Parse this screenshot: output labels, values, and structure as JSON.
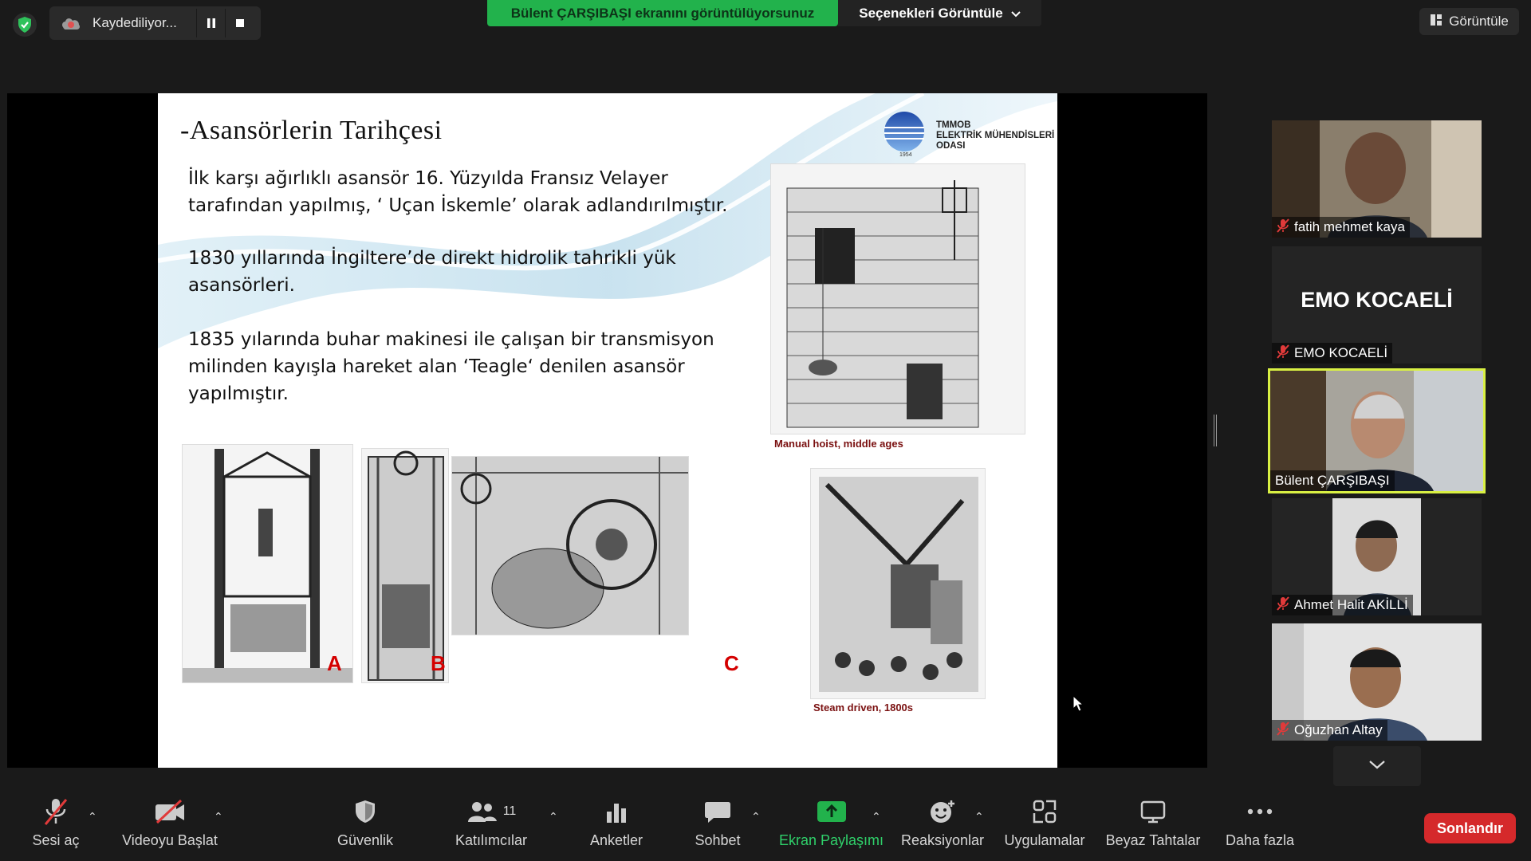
{
  "top": {
    "recording_label": "Kaydediliyor...",
    "share_banner": "Bülent ÇARŞIBAŞI ekranını görüntülüyorsunuz",
    "options_label": "Seçenekleri Görüntüle",
    "view_label": "Görüntüle"
  },
  "slide": {
    "title": "-Asansörlerin   Tarihçesi",
    "logo_lines": [
      "TMMOB",
      "ELEKTRİK MÜHENDİSLERİ",
      "ODASI"
    ],
    "logo_year": "1954",
    "paragraphs": [
      "İlk karşı ağırlıklı asansör 16. Yüzyılda Fransız Velayer tarafından yapılmış, ‘ Uçan İskemle’ olarak adlandırılmıştır.",
      "1830 yıllarında İngiltere’de direkt hidrolik tahrikli yük asansörleri.",
      "1835 yılarında buhar makinesi ile çalışan bir transmisyon milinden kayışla hareket alan ‘Teagle‘ denilen asansör yapılmıştır."
    ],
    "caption_hoist": "Manual hoist, middle ages",
    "caption_steam": "Steam driven, 1800s",
    "letters": [
      "A",
      "B",
      "C"
    ]
  },
  "participants": [
    {
      "name": "fatih mehmet kaya",
      "muted": true,
      "video": true
    },
    {
      "name": "EMO KOCAELİ",
      "muted": true,
      "video": false,
      "display": "EMO KOCAELİ"
    },
    {
      "name": "Bülent ÇARŞIBAŞI",
      "muted": false,
      "video": true,
      "active": true
    },
    {
      "name": "Ahmet Halit AKİLLİ",
      "muted": true,
      "video": true
    },
    {
      "name": "Oğuzhan Altay",
      "muted": true,
      "video": true
    }
  ],
  "toolbar": {
    "unmute": "Sesi aç",
    "start_video": "Videoyu Başlat",
    "security": "Güvenlik",
    "participants": "Katılımcılar",
    "participants_count": "11",
    "polls": "Anketler",
    "chat": "Sohbet",
    "share": "Ekran Paylaşımı",
    "reactions": "Reaksiyonlar",
    "apps": "Uygulamalar",
    "whiteboards": "Beyaz Tahtalar",
    "more": "Daha fazla",
    "end": "Sonlandır"
  },
  "colors": {
    "share_green": "#22b24c",
    "active_speaker": "#d9f043",
    "end_red": "#d5292b",
    "muted_red": "#e03a3a"
  }
}
